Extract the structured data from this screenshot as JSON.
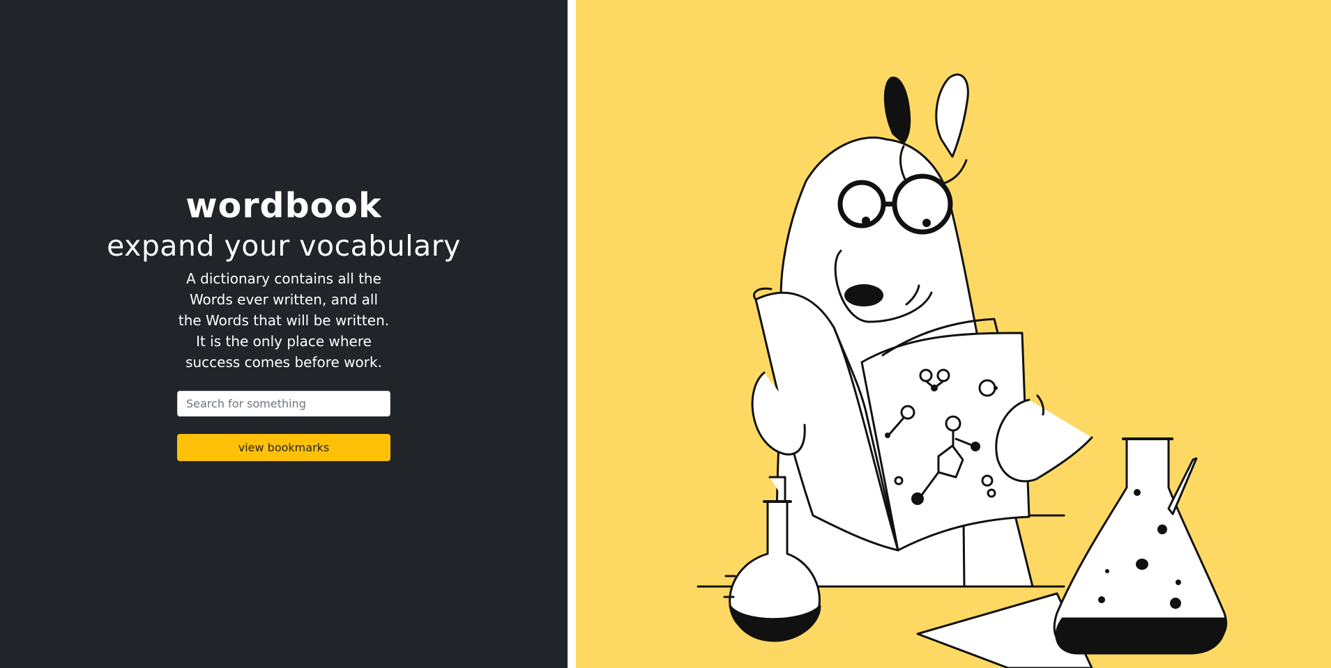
{
  "hero": {
    "title": "wordbook",
    "tagline": "expand your vocabulary",
    "description_lines": [
      "A dictionary contains all the",
      "Words ever written, and all",
      "the Words that will be written.",
      "It is the only place where",
      "success comes before work."
    ]
  },
  "search": {
    "placeholder": "Search for something",
    "value": ""
  },
  "actions": {
    "bookmarks_label": "view bookmarks"
  },
  "colors": {
    "left_background": "#212529",
    "right_background": "#fdd963",
    "accent": "#ffc107"
  },
  "illustration": {
    "subject": "dog-scientist-reading-book-icon"
  }
}
